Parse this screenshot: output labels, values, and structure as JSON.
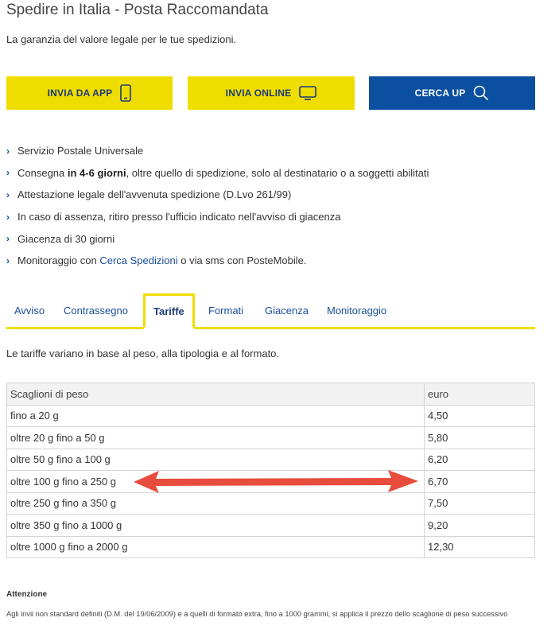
{
  "header": {
    "title": "Spedire in Italia - Posta Raccomandata",
    "subtitle": "La garanzia del valore legale per le tue spedizioni."
  },
  "actions": {
    "app_label": "INVIA DA APP",
    "online_label": "INVIA ONLINE",
    "search_label": "CERCA UP"
  },
  "features": {
    "item1": "Servizio Postale Universale",
    "item2_pre": "Consegna ",
    "item2_bold": "in 4-6 giorni",
    "item2_post": ", oltre quello di spedizione, solo al destinatario o a soggetti abilitati",
    "item3": "Attestazione legale dell'avvenuta spedizione (D.Lvo 261/99)",
    "item4": "In caso di assenza, ritiro presso l'ufficio indicato nell'avviso di giacenza",
    "item5": "Giacenza di 30 giorni",
    "item6_pre": "Monitoraggio con ",
    "item6_link": "Cerca Spedizioni",
    "item6_post": " o via sms con PosteMobile."
  },
  "tabs": {
    "t1": "Avviso",
    "t2": "Contrassegno",
    "t3": "Tariffe",
    "t4": "Formati",
    "t5": "Giacenza",
    "t6": "Monitoraggio",
    "active": "Tariffe"
  },
  "tariffe": {
    "intro": "Le tariffe variano in base al peso, alla tipologia e al formato.",
    "col_weight": "Scaglioni di peso",
    "col_price": "euro",
    "rows": [
      {
        "weight": "fino a 20 g",
        "price": "4,50"
      },
      {
        "weight": "oltre 20 g fino a 50 g",
        "price": "5,80"
      },
      {
        "weight": "oltre 50 g fino a 100 g",
        "price": "6,20"
      },
      {
        "weight": "oltre 100 g fino a 250 g",
        "price": "6,70"
      },
      {
        "weight": "oltre 250 g fino a 350 g",
        "price": "7,50"
      },
      {
        "weight": "oltre 350 g fino a 1000 g",
        "price": "9,20"
      },
      {
        "weight": "oltre 1000 g fino a 2000 g",
        "price": "12,30"
      }
    ]
  },
  "annotation": {
    "arrow_color": "#e74c3c"
  },
  "attention": {
    "title": "Attenzione",
    "text": "Agli invii non standard definiti (D.M. del 19/06/2009) e a quelli di formato extra, fino a 1000 grammi, si applica il prezzo dello scaglione di peso successivo"
  },
  "colors": {
    "brand_yellow": "#f0dd00",
    "brand_blue": "#0a4fa0",
    "link_blue": "#1a4c9a"
  }
}
